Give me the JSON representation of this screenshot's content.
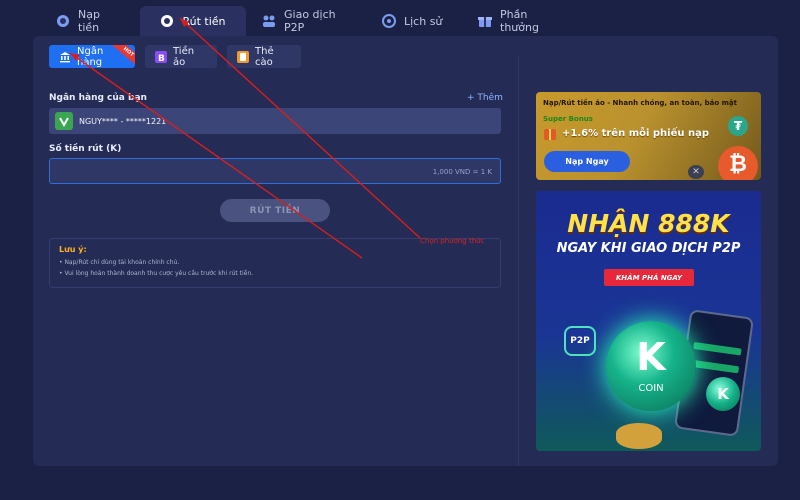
{
  "top_tabs": [
    {
      "label": "Nạp tiền",
      "icon": "deposit-icon"
    },
    {
      "label": "Rút tiền",
      "icon": "withdraw-icon",
      "active": true
    },
    {
      "label": "Giao dịch P2P",
      "icon": "p2p-icon"
    },
    {
      "label": "Lịch sử",
      "icon": "history-icon"
    },
    {
      "label": "Phần thưởng",
      "icon": "gift-icon"
    }
  ],
  "sub_tabs": [
    {
      "label": "Ngân hàng",
      "icon": "bank-icon",
      "active": true,
      "badge": "HOT"
    },
    {
      "label": "Tiền ảo",
      "icon": "crypto-icon"
    },
    {
      "label": "Thẻ cào",
      "icon": "card-icon"
    }
  ],
  "form": {
    "bank_label": "Ngân hàng của bạn",
    "add_label": "+ Thêm",
    "bank_value": "NGUY**** - *****1221",
    "amount_label": "Số tiền rút (K)",
    "amount_placeholder": "1,000 VND = 1 K",
    "submit_label": "RÚT TIỀN"
  },
  "note": {
    "title": "Lưu ý:",
    "lines": [
      "• Nạp/Rút chỉ dùng tài khoản chính chủ.",
      "• Vui lòng hoàn thành doanh thu cược yêu cầu trước khi rút tiền."
    ]
  },
  "annotation": "Chọn phương thức",
  "promo": {
    "headline": "Nạp/Rút tiền ảo - Nhanh chóng, an toàn, bảo mật",
    "bonus_label": "Super Bonus",
    "rate_text": "+1.6% trên mỗi phiếu nạp",
    "button_label": "Nạp Ngay"
  },
  "banner": {
    "title": "NHẬN 888K",
    "subtitle": "NGAY KHI GIAO DỊCH P2P",
    "button_label": "KHÁM PHÁ NGAY",
    "p2p_badge": "P2P",
    "coin_letter": "K",
    "coin_label": "COIN"
  },
  "colors": {
    "background": "#1b2144",
    "panel": "#242b55",
    "accent": "#1e6ff2",
    "annotation": "#e02020"
  }
}
